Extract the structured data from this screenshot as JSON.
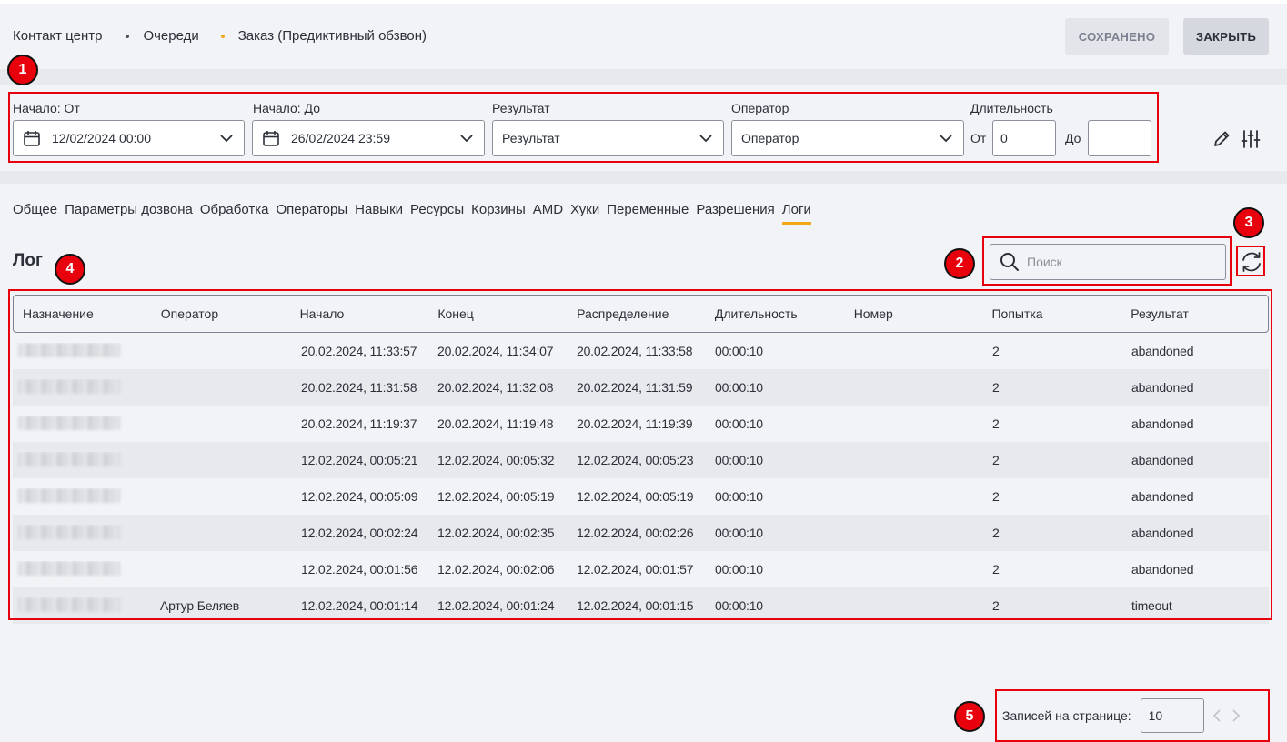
{
  "breadcrumb": [
    "Контакт центр",
    "Очереди",
    "Заказ (Предиктивный обзвон)"
  ],
  "header": {
    "saved_label": "СОХРАНЕНО",
    "close_label": "ЗАКРЫТЬ"
  },
  "filters": {
    "start_from": {
      "label": "Начало: От",
      "value": "12/02/2024 00:00"
    },
    "start_to": {
      "label": "Начало: До",
      "value": "26/02/2024 23:59"
    },
    "result": {
      "label": "Результат",
      "value": "Результат"
    },
    "operator": {
      "label": "Оператор",
      "value": "Оператор"
    },
    "duration": {
      "label": "Длительность",
      "from_label": "От",
      "from_value": "0",
      "to_label": "До",
      "to_value": ""
    }
  },
  "tabs": [
    "Общее",
    "Параметры дозвона",
    "Обработка",
    "Операторы",
    "Навыки",
    "Ресурсы",
    "Корзины",
    "AMD",
    "Хуки",
    "Переменные",
    "Разрешения",
    "Логи"
  ],
  "active_tab": "Логи",
  "log": {
    "title": "Лог",
    "search_placeholder": "Поиск"
  },
  "table": {
    "columns": [
      "Назначение",
      "Оператор",
      "Начало",
      "Конец",
      "Распределение",
      "Длительность",
      "Номер",
      "Попытка",
      "Результат"
    ],
    "rows": [
      {
        "operator": "",
        "start": "20.02.2024, 11:33:57",
        "end": "20.02.2024, 11:34:07",
        "distribution": "20.02.2024, 11:33:58",
        "duration": "00:00:10",
        "number": "",
        "attempt": "2",
        "result": "abandoned"
      },
      {
        "operator": "",
        "start": "20.02.2024, 11:31:58",
        "end": "20.02.2024, 11:32:08",
        "distribution": "20.02.2024, 11:31:59",
        "duration": "00:00:10",
        "number": "",
        "attempt": "2",
        "result": "abandoned"
      },
      {
        "operator": "",
        "start": "20.02.2024, 11:19:37",
        "end": "20.02.2024, 11:19:48",
        "distribution": "20.02.2024, 11:19:39",
        "duration": "00:00:10",
        "number": "",
        "attempt": "2",
        "result": "abandoned"
      },
      {
        "operator": "",
        "start": "12.02.2024, 00:05:21",
        "end": "12.02.2024, 00:05:32",
        "distribution": "12.02.2024, 00:05:23",
        "duration": "00:00:10",
        "number": "",
        "attempt": "2",
        "result": "abandoned"
      },
      {
        "operator": "",
        "start": "12.02.2024, 00:05:09",
        "end": "12.02.2024, 00:05:19",
        "distribution": "12.02.2024, 00:05:19",
        "duration": "00:00:10",
        "number": "",
        "attempt": "2",
        "result": "abandoned"
      },
      {
        "operator": "",
        "start": "12.02.2024, 00:02:24",
        "end": "12.02.2024, 00:02:35",
        "distribution": "12.02.2024, 00:02:26",
        "duration": "00:00:10",
        "number": "",
        "attempt": "2",
        "result": "abandoned"
      },
      {
        "operator": "",
        "start": "12.02.2024, 00:01:56",
        "end": "12.02.2024, 00:02:06",
        "distribution": "12.02.2024, 00:01:57",
        "duration": "00:00:10",
        "number": "",
        "attempt": "2",
        "result": "abandoned"
      },
      {
        "operator": "Артур Беляев",
        "start": "12.02.2024, 00:01:14",
        "end": "12.02.2024, 00:01:24",
        "distribution": "12.02.2024, 00:01:15",
        "duration": "00:00:10",
        "number": "",
        "attempt": "2",
        "result": "timeout"
      }
    ]
  },
  "pagination": {
    "label": "Записей на странице:",
    "value": "10"
  },
  "annotations": [
    "1",
    "2",
    "3",
    "4",
    "5"
  ],
  "colors": {
    "accent": "#f3a712",
    "annotation": "#e8000c"
  }
}
